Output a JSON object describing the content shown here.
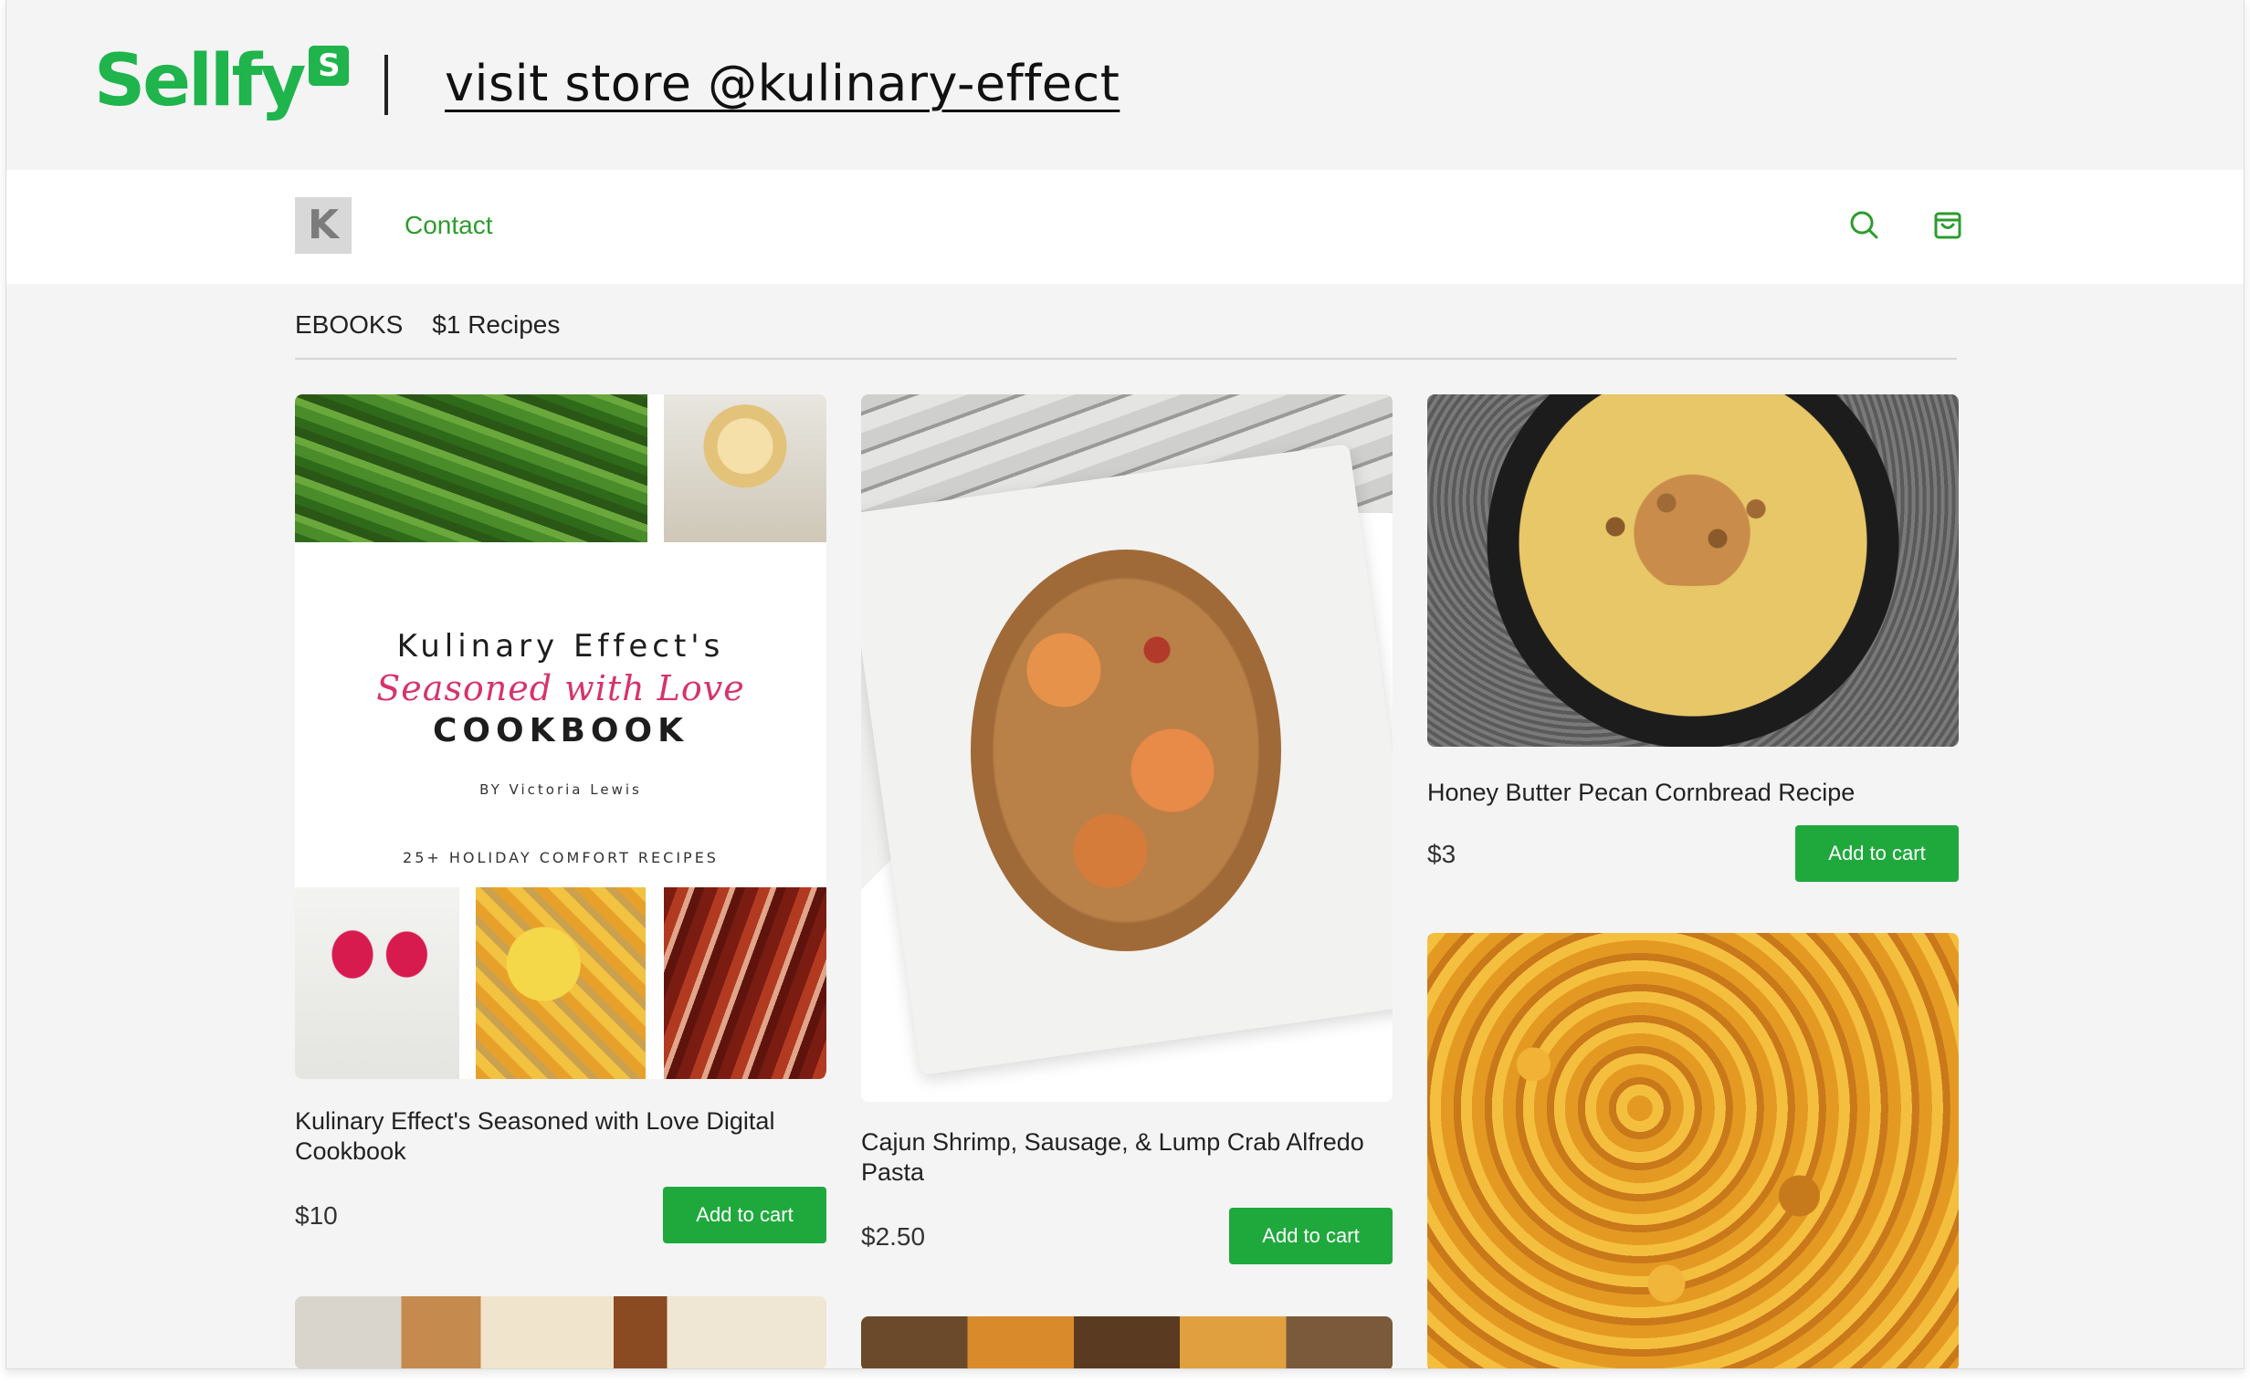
{
  "banner": {
    "logo_text": "Sellfy",
    "logo_badge": "S",
    "store_link": "visit store @kulinary-effect"
  },
  "navbar": {
    "avatar_letter": "K",
    "contact_label": "Contact",
    "search_icon": "search-icon",
    "cart_icon": "shopping-bag-icon"
  },
  "categories": [
    "EBOOKS",
    "$1 Recipes"
  ],
  "products": [
    {
      "title": "Kulinary Effect's Seasoned with Love Digital Cookbook",
      "price": "$10",
      "button": "Add to cart",
      "cover": {
        "line1": "Kulinary Effect's",
        "line2": "Seasoned with Love",
        "line3": "COOKBOOK",
        "author": "BY Victoria Lewis",
        "tagline": "25+ HOLIDAY COMFORT RECIPES"
      }
    },
    {
      "title": "Cajun Shrimp, Sausage, & Lump Crab Alfredo Pasta",
      "price": "$2.50",
      "button": "Add to cart"
    },
    {
      "title": "Honey Butter Pecan Cornbread Recipe",
      "price": "$3",
      "button": "Add to cart"
    }
  ],
  "colors": {
    "brand_green": "#1fb44c",
    "button_green": "#1fa93d",
    "link_green": "#2d9c2d"
  }
}
